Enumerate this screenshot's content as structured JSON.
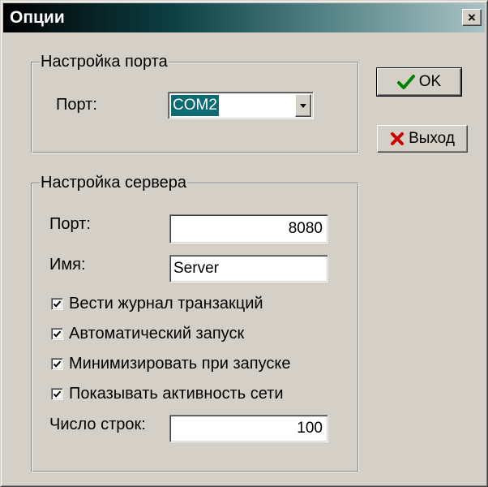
{
  "window": {
    "title": "Опции",
    "close_glyph": "×"
  },
  "port_group": {
    "legend": "Настройка порта",
    "port_label": "Порт:",
    "port_value": "COM2"
  },
  "server_group": {
    "legend": "Настройка сервера",
    "port_label": "Порт:",
    "port_value": "8080",
    "name_label": "Имя:",
    "name_value": "Server",
    "checkboxes": [
      {
        "label": "Вести журнал транзакций",
        "checked": true
      },
      {
        "label": "Автоматический запуск",
        "checked": true
      },
      {
        "label": "Минимизировать при запуске",
        "checked": true
      },
      {
        "label": "Показывать активность сети",
        "checked": true
      }
    ],
    "lines_label": "Число строк:",
    "lines_value": "100"
  },
  "buttons": {
    "ok_label": "OK",
    "exit_label": "Выход"
  },
  "icons": {
    "ok": "check-icon",
    "exit": "x-icon",
    "ok_color": "#008000",
    "exit_color": "#cc0000"
  },
  "colors": {
    "face": "#d4d0c8",
    "selection": "#0c6b73"
  }
}
